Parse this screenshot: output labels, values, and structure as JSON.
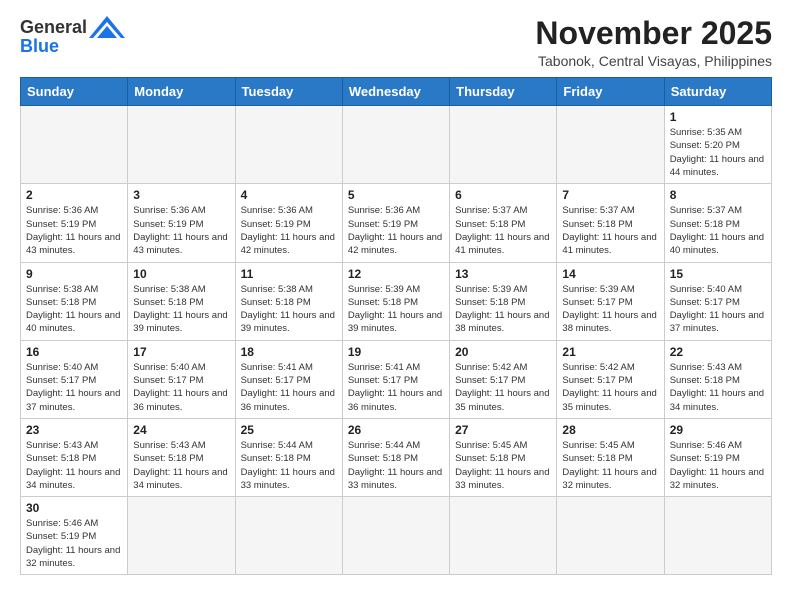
{
  "header": {
    "logo_general": "General",
    "logo_blue": "Blue",
    "month_title": "November 2025",
    "subtitle": "Tabonok, Central Visayas, Philippines"
  },
  "weekdays": [
    "Sunday",
    "Monday",
    "Tuesday",
    "Wednesday",
    "Thursday",
    "Friday",
    "Saturday"
  ],
  "days": [
    {
      "date": "",
      "sunrise": "",
      "sunset": "",
      "daylight": ""
    },
    {
      "date": "",
      "sunrise": "",
      "sunset": "",
      "daylight": ""
    },
    {
      "date": "",
      "sunrise": "",
      "sunset": "",
      "daylight": ""
    },
    {
      "date": "",
      "sunrise": "",
      "sunset": "",
      "daylight": ""
    },
    {
      "date": "",
      "sunrise": "",
      "sunset": "",
      "daylight": ""
    },
    {
      "date": "",
      "sunrise": "",
      "sunset": "",
      "daylight": ""
    },
    {
      "date": "1",
      "sunrise": "Sunrise: 5:35 AM",
      "sunset": "Sunset: 5:20 PM",
      "daylight": "Daylight: 11 hours and 44 minutes."
    },
    {
      "date": "2",
      "sunrise": "Sunrise: 5:36 AM",
      "sunset": "Sunset: 5:19 PM",
      "daylight": "Daylight: 11 hours and 43 minutes."
    },
    {
      "date": "3",
      "sunrise": "Sunrise: 5:36 AM",
      "sunset": "Sunset: 5:19 PM",
      "daylight": "Daylight: 11 hours and 43 minutes."
    },
    {
      "date": "4",
      "sunrise": "Sunrise: 5:36 AM",
      "sunset": "Sunset: 5:19 PM",
      "daylight": "Daylight: 11 hours and 42 minutes."
    },
    {
      "date": "5",
      "sunrise": "Sunrise: 5:36 AM",
      "sunset": "Sunset: 5:19 PM",
      "daylight": "Daylight: 11 hours and 42 minutes."
    },
    {
      "date": "6",
      "sunrise": "Sunrise: 5:37 AM",
      "sunset": "Sunset: 5:18 PM",
      "daylight": "Daylight: 11 hours and 41 minutes."
    },
    {
      "date": "7",
      "sunrise": "Sunrise: 5:37 AM",
      "sunset": "Sunset: 5:18 PM",
      "daylight": "Daylight: 11 hours and 41 minutes."
    },
    {
      "date": "8",
      "sunrise": "Sunrise: 5:37 AM",
      "sunset": "Sunset: 5:18 PM",
      "daylight": "Daylight: 11 hours and 40 minutes."
    },
    {
      "date": "9",
      "sunrise": "Sunrise: 5:38 AM",
      "sunset": "Sunset: 5:18 PM",
      "daylight": "Daylight: 11 hours and 40 minutes."
    },
    {
      "date": "10",
      "sunrise": "Sunrise: 5:38 AM",
      "sunset": "Sunset: 5:18 PM",
      "daylight": "Daylight: 11 hours and 39 minutes."
    },
    {
      "date": "11",
      "sunrise": "Sunrise: 5:38 AM",
      "sunset": "Sunset: 5:18 PM",
      "daylight": "Daylight: 11 hours and 39 minutes."
    },
    {
      "date": "12",
      "sunrise": "Sunrise: 5:39 AM",
      "sunset": "Sunset: 5:18 PM",
      "daylight": "Daylight: 11 hours and 39 minutes."
    },
    {
      "date": "13",
      "sunrise": "Sunrise: 5:39 AM",
      "sunset": "Sunset: 5:18 PM",
      "daylight": "Daylight: 11 hours and 38 minutes."
    },
    {
      "date": "14",
      "sunrise": "Sunrise: 5:39 AM",
      "sunset": "Sunset: 5:17 PM",
      "daylight": "Daylight: 11 hours and 38 minutes."
    },
    {
      "date": "15",
      "sunrise": "Sunrise: 5:40 AM",
      "sunset": "Sunset: 5:17 PM",
      "daylight": "Daylight: 11 hours and 37 minutes."
    },
    {
      "date": "16",
      "sunrise": "Sunrise: 5:40 AM",
      "sunset": "Sunset: 5:17 PM",
      "daylight": "Daylight: 11 hours and 37 minutes."
    },
    {
      "date": "17",
      "sunrise": "Sunrise: 5:40 AM",
      "sunset": "Sunset: 5:17 PM",
      "daylight": "Daylight: 11 hours and 36 minutes."
    },
    {
      "date": "18",
      "sunrise": "Sunrise: 5:41 AM",
      "sunset": "Sunset: 5:17 PM",
      "daylight": "Daylight: 11 hours and 36 minutes."
    },
    {
      "date": "19",
      "sunrise": "Sunrise: 5:41 AM",
      "sunset": "Sunset: 5:17 PM",
      "daylight": "Daylight: 11 hours and 36 minutes."
    },
    {
      "date": "20",
      "sunrise": "Sunrise: 5:42 AM",
      "sunset": "Sunset: 5:17 PM",
      "daylight": "Daylight: 11 hours and 35 minutes."
    },
    {
      "date": "21",
      "sunrise": "Sunrise: 5:42 AM",
      "sunset": "Sunset: 5:17 PM",
      "daylight": "Daylight: 11 hours and 35 minutes."
    },
    {
      "date": "22",
      "sunrise": "Sunrise: 5:43 AM",
      "sunset": "Sunset: 5:18 PM",
      "daylight": "Daylight: 11 hours and 34 minutes."
    },
    {
      "date": "23",
      "sunrise": "Sunrise: 5:43 AM",
      "sunset": "Sunset: 5:18 PM",
      "daylight": "Daylight: 11 hours and 34 minutes."
    },
    {
      "date": "24",
      "sunrise": "Sunrise: 5:43 AM",
      "sunset": "Sunset: 5:18 PM",
      "daylight": "Daylight: 11 hours and 34 minutes."
    },
    {
      "date": "25",
      "sunrise": "Sunrise: 5:44 AM",
      "sunset": "Sunset: 5:18 PM",
      "daylight": "Daylight: 11 hours and 33 minutes."
    },
    {
      "date": "26",
      "sunrise": "Sunrise: 5:44 AM",
      "sunset": "Sunset: 5:18 PM",
      "daylight": "Daylight: 11 hours and 33 minutes."
    },
    {
      "date": "27",
      "sunrise": "Sunrise: 5:45 AM",
      "sunset": "Sunset: 5:18 PM",
      "daylight": "Daylight: 11 hours and 33 minutes."
    },
    {
      "date": "28",
      "sunrise": "Sunrise: 5:45 AM",
      "sunset": "Sunset: 5:18 PM",
      "daylight": "Daylight: 11 hours and 32 minutes."
    },
    {
      "date": "29",
      "sunrise": "Sunrise: 5:46 AM",
      "sunset": "Sunset: 5:19 PM",
      "daylight": "Daylight: 11 hours and 32 minutes."
    },
    {
      "date": "30",
      "sunrise": "Sunrise: 5:46 AM",
      "sunset": "Sunset: 5:19 PM",
      "daylight": "Daylight: 11 hours and 32 minutes."
    }
  ]
}
